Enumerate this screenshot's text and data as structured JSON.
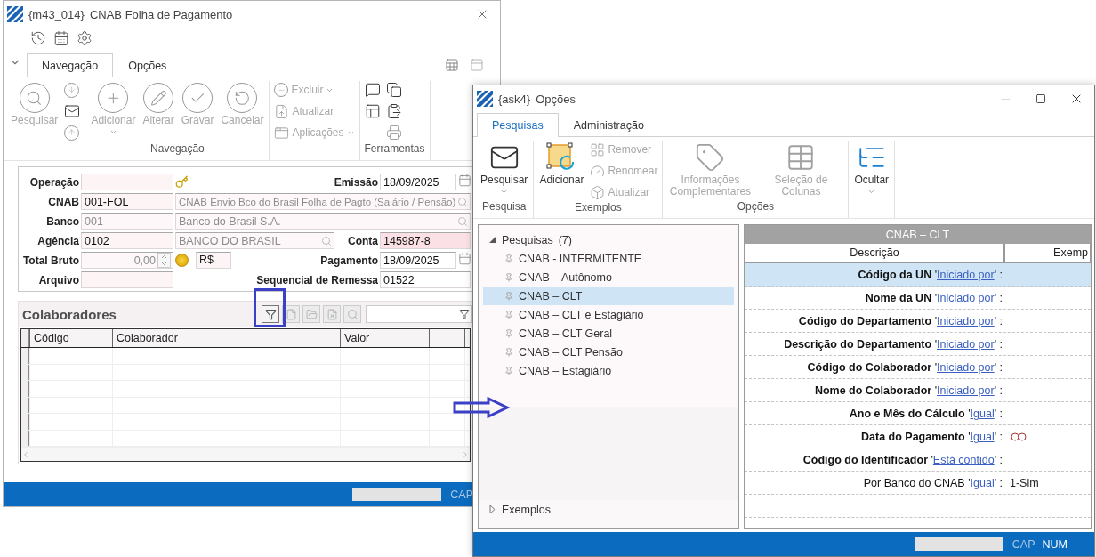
{
  "main_window": {
    "code": "{m43_014}",
    "title": "CNAB Folha de Pagamento",
    "tabs": [
      {
        "label": "Navegação",
        "selected": true
      },
      {
        "label": "Opções",
        "selected": false
      }
    ],
    "ribbon_groups": [
      {
        "columns": [
          [
            {
              "kind": "large",
              "label": "Pesquisar",
              "disabled": true
            }
          ],
          [
            {
              "kind": "icon",
              "disabled": true
            },
            {
              "kind": "icon",
              "disabled": false
            },
            {
              "kind": "icon",
              "disabled": true
            }
          ]
        ]
      },
      {
        "label": "Navegação",
        "columns": [
          [
            {
              "kind": "large",
              "label": "Adicionar",
              "disabled": true,
              "dropdown": true
            }
          ],
          [
            {
              "kind": "large",
              "label": "Alterar",
              "disabled": true
            }
          ],
          [
            {
              "kind": "large",
              "label": "Gravar",
              "disabled": true
            }
          ],
          [
            {
              "kind": "large",
              "label": "Cancelar",
              "disabled": true
            }
          ]
        ]
      },
      {
        "columns": [
          [
            {
              "kind": "small",
              "label": "Excluir",
              "disabled": true,
              "dropdown": true
            },
            {
              "kind": "small",
              "label": "Atualizar",
              "disabled": true
            },
            {
              "kind": "small",
              "label": "Aplicações",
              "disabled": true,
              "dropdown": true
            }
          ]
        ]
      },
      {
        "label": "Ferramentas",
        "columns": [
          [
            {
              "kind": "icon",
              "disabled": false
            },
            {
              "kind": "icon",
              "disabled": false
            }
          ],
          [
            {
              "kind": "icon",
              "disabled": false
            },
            {
              "kind": "icon",
              "disabled": false
            },
            {
              "kind": "icon",
              "disabled": true
            }
          ]
        ]
      }
    ],
    "form": {
      "operacao": {
        "label": "Operação"
      },
      "emissao": {
        "label": "Emissão",
        "value": "18/09/2025"
      },
      "cnab": {
        "label": "CNAB",
        "code": "001-FOL",
        "description": "CNAB Envio Bco do Brasil Folha de Pagto (Salário / Pensão)"
      },
      "banco": {
        "label": "Banco",
        "code": "001",
        "description": "Banco do Brasil S.A.",
        "code_disabled": true
      },
      "agencia": {
        "label": "Agência",
        "code": "0102",
        "description": "BANCO DO BRASIL"
      },
      "conta": {
        "label": "Conta",
        "value": "145987-8",
        "invalid": true
      },
      "total_bruto": {
        "label": "Total Bruto",
        "value": "0,00",
        "value_disabled": true,
        "currency": "R$"
      },
      "pagamento": {
        "label": "Pagamento",
        "value": "18/09/2025"
      },
      "arquivo": {
        "label": "Arquivo"
      },
      "sequencial": {
        "label": "Sequencial de Remessa",
        "value": "01522"
      }
    },
    "colaboradores": {
      "title": "Colaboradores",
      "columns": [
        "Código",
        "Colaborador",
        "Valor"
      ]
    },
    "status_bar": {
      "indicators": [
        {
          "label": "CAP",
          "on": false
        }
      ]
    }
  },
  "options_window": {
    "code": "{ask4}",
    "title": "Opções",
    "tabs": [
      {
        "label": "Pesquisas",
        "selected": true
      },
      {
        "label": "Administração",
        "selected": false
      }
    ],
    "ribbon_groups": [
      {
        "label": "Pesquisa",
        "columns": [
          [
            {
              "kind": "large",
              "label": "Pesquisar",
              "disabled": false,
              "dropdown": true
            }
          ]
        ]
      },
      {
        "label": "Exemplos",
        "columns": [
          [
            {
              "kind": "large",
              "label": "Adicionar",
              "disabled": false
            }
          ],
          [
            {
              "kind": "small",
              "label": "Remover",
              "disabled": true
            },
            {
              "kind": "small",
              "label": "Renomear",
              "disabled": true
            },
            {
              "kind": "small",
              "label": "Atualizar",
              "disabled": true
            }
          ]
        ]
      },
      {
        "label": "Opções",
        "columns": [
          [
            {
              "kind": "large",
              "label": "Informações Complementares",
              "disabled": true
            }
          ],
          [
            {
              "kind": "large",
              "label": "Seleção de Colunas",
              "disabled": true
            }
          ]
        ]
      },
      {
        "columns": [
          [
            {
              "kind": "large",
              "label": "Ocultar",
              "disabled": false,
              "dropdown": true
            }
          ]
        ]
      }
    ],
    "tree": [
      {
        "label": "Pesquisas",
        "count": "(7)",
        "expanded": true,
        "children": [
          {
            "label": "CNAB - INTERMITENTE",
            "selected": false
          },
          {
            "label": "CNAB – Autônomo",
            "selected": false
          },
          {
            "label": "CNAB – CLT",
            "selected": true
          },
          {
            "label": "CNAB – CLT e Estagiário",
            "selected": false
          },
          {
            "label": "CNAB – CLT Geral",
            "selected": false
          },
          {
            "label": "CNAB – CLT Pensão",
            "selected": false
          },
          {
            "label": "CNAB – Estagiário",
            "selected": false
          }
        ]
      },
      {
        "label": "Exemplos",
        "expanded": false
      }
    ],
    "grid": {
      "title": "CNAB – CLT",
      "columns": [
        "Descrição",
        "Exemp"
      ],
      "rows": [
        {
          "kind": "empty",
          "label": "**Código da UN** '",
          "operator": "Iniciado por",
          "close": "' :",
          "selected": true
        },
        {
          "kind": "empty",
          "label": "**Nome da UN** '",
          "operator": "Iniciado por",
          "close": "' :",
          "selected": false
        },
        {
          "kind": "empty",
          "label": "**Código do Departamento** '",
          "operator": "Iniciado por",
          "close": "' :",
          "selected": false
        },
        {
          "kind": "empty",
          "label": "**Descrição do Departamento** '",
          "operator": "Iniciado por",
          "close": "' :",
          "selected": false
        },
        {
          "kind": "empty",
          "label": "**Código do Colaborador** '",
          "operator": "Iniciado por",
          "close": "' :",
          "selected": false
        },
        {
          "kind": "empty",
          "label": "**Nome do Colaborador** '",
          "operator": "Iniciado por",
          "close": "' :",
          "selected": false
        },
        {
          "kind": "empty",
          "label": "**Ano e Mês do Cálculo** '",
          "operator": "Igual",
          "close": "' :",
          "selected": false
        },
        {
          "kind": "icon",
          "label": "**Data do Pagamento** '",
          "operator": "Igual",
          "close": "' :",
          "selected": false
        },
        {
          "kind": "empty",
          "label": "**Código do Identificador** '",
          "operator": "Está contido",
          "close": "' :",
          "selected": false
        },
        {
          "kind": "text",
          "label": "Por Banco do CNAB '",
          "operator": "Igual",
          "close": "' :",
          "value": "1-Sim",
          "selected": false
        }
      ]
    },
    "status_bar": {
      "indicators": [
        {
          "label": "CAP",
          "on": false
        },
        {
          "label": "NUM",
          "on": true
        }
      ]
    }
  }
}
